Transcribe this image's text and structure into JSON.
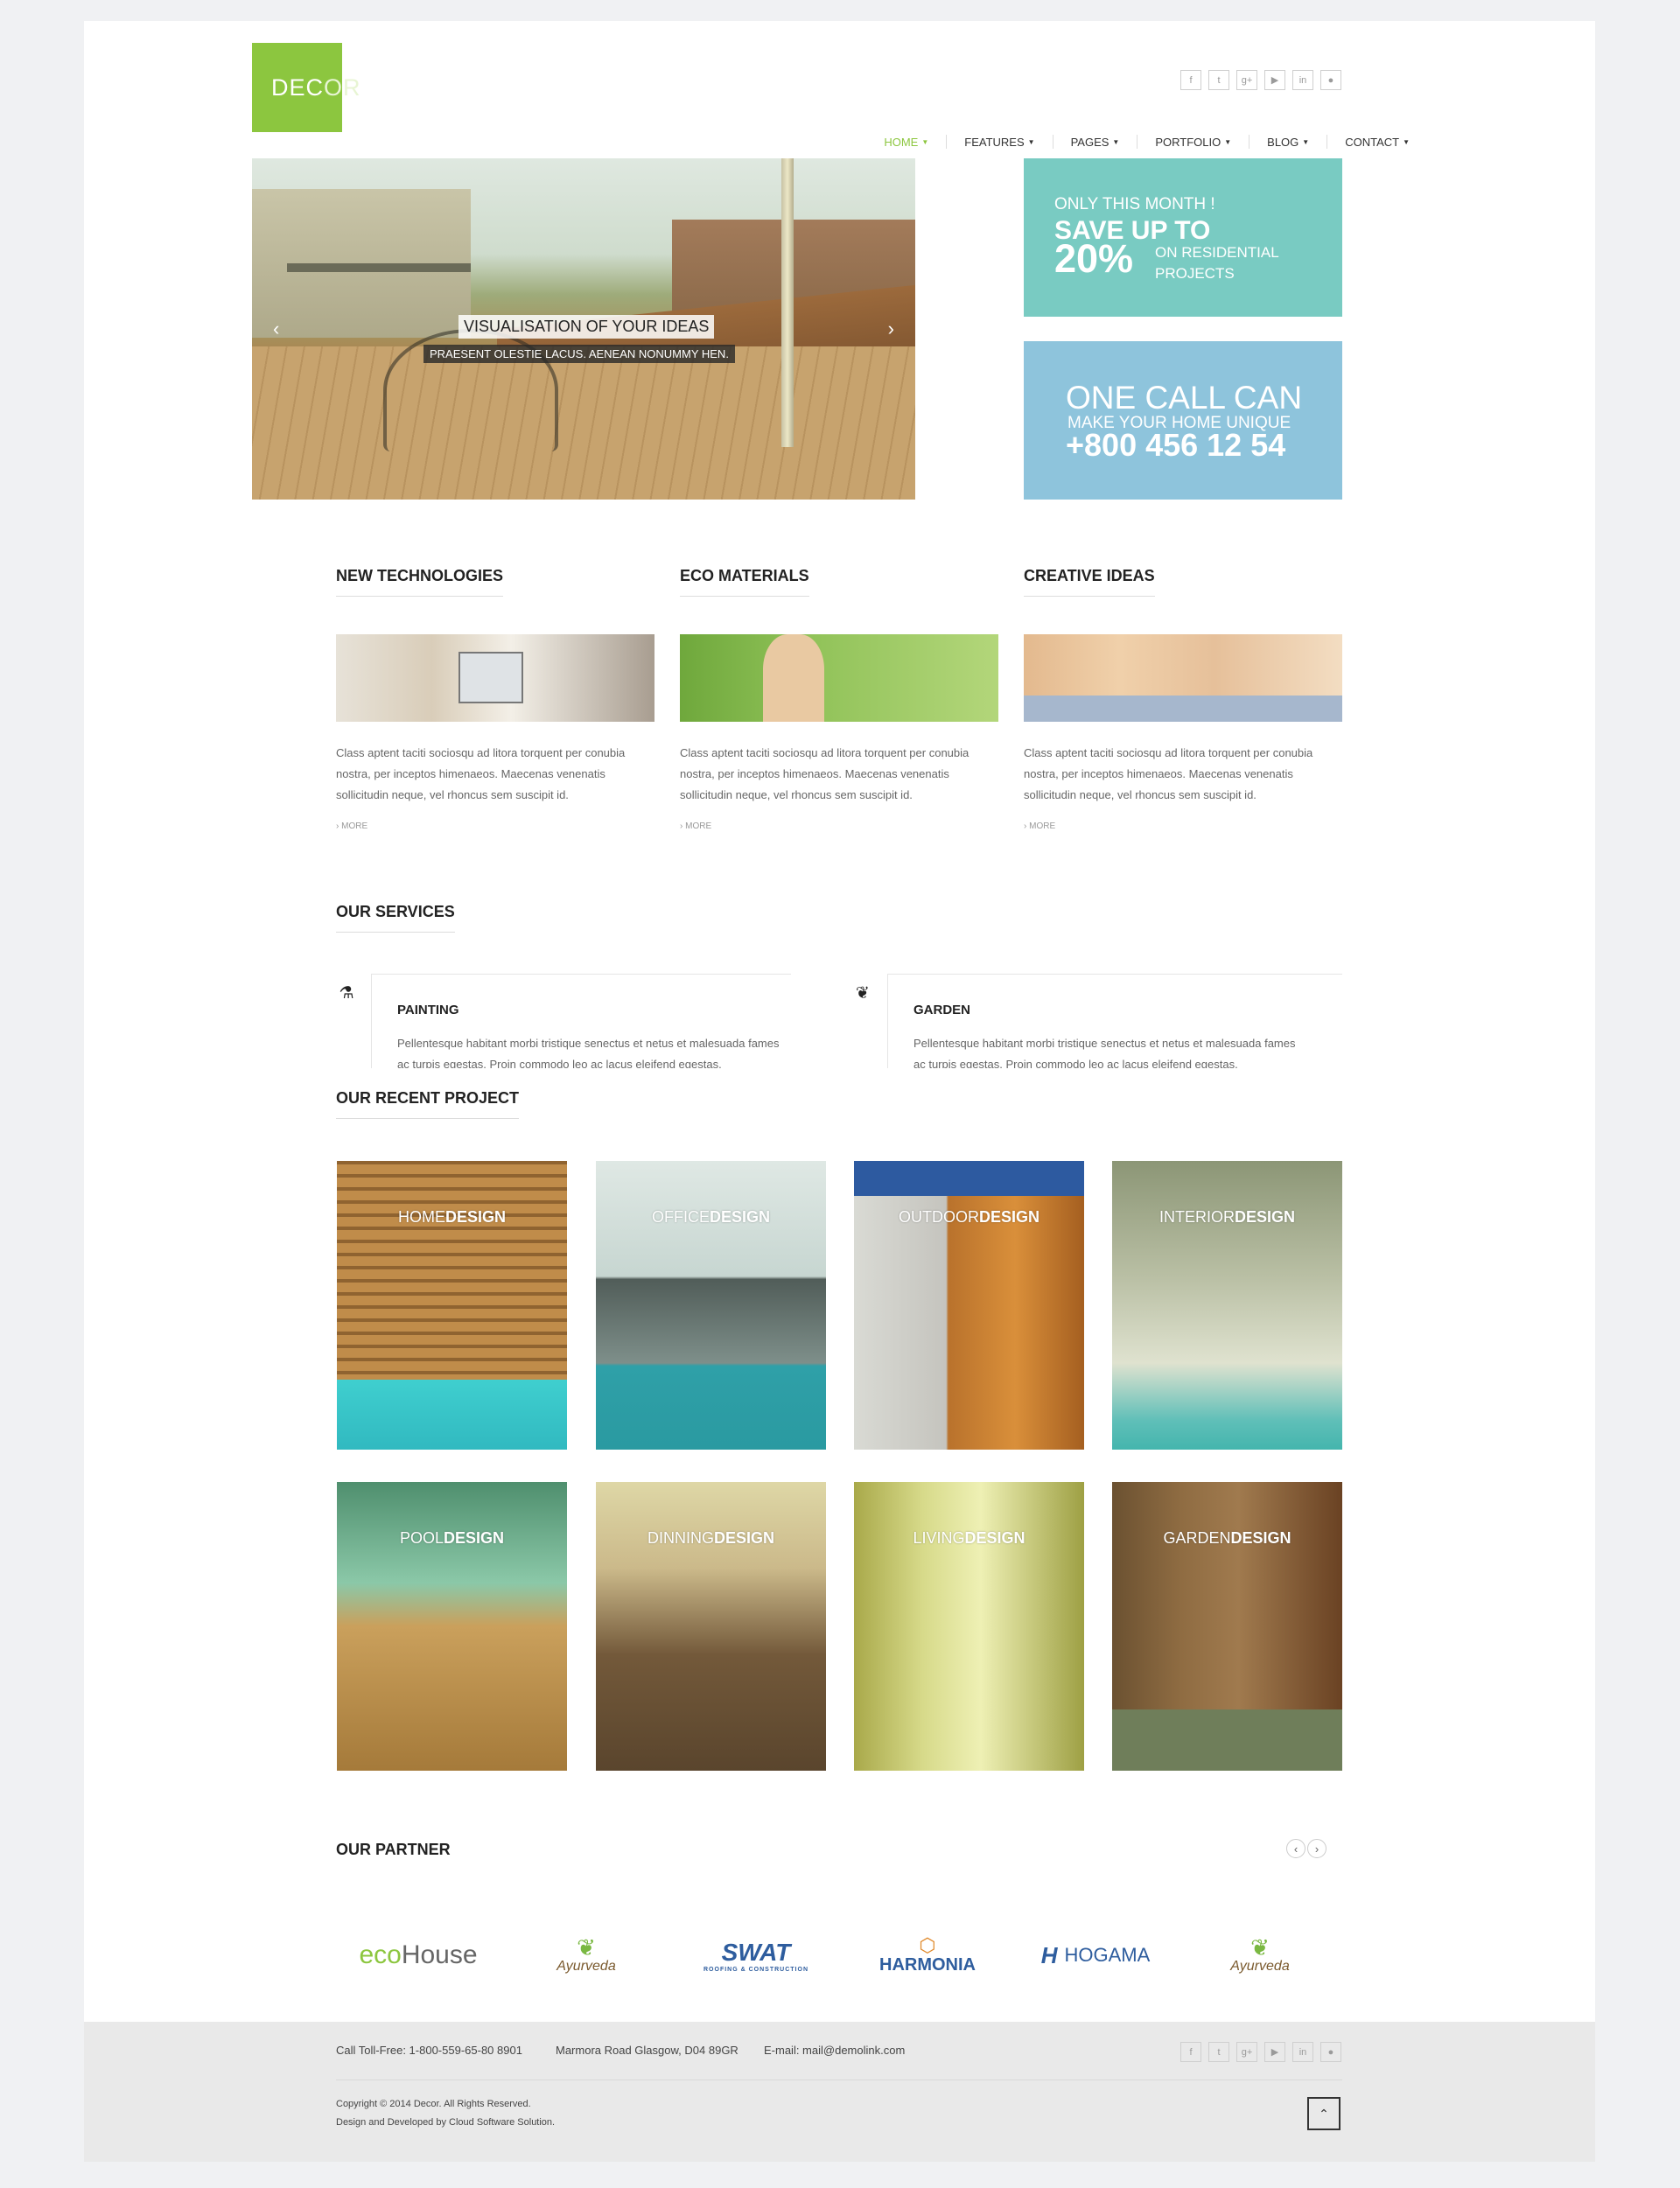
{
  "header": {
    "logo": {
      "prefix": "DEC",
      "suffix": "OR"
    },
    "social_icons": [
      "facebook-icon",
      "twitter-icon",
      "google-plus-icon",
      "youtube-icon",
      "linkedin-icon",
      "flickr-icon"
    ],
    "social_glyphs": [
      "f",
      "t",
      "g+",
      "▶",
      "in",
      "●"
    ],
    "nav": [
      {
        "label": "HOME",
        "active": true
      },
      {
        "label": "FEATURES",
        "active": false
      },
      {
        "label": "PAGES",
        "active": false
      },
      {
        "label": "PORTFOLIO",
        "active": false
      },
      {
        "label": "BLOG",
        "active": false
      },
      {
        "label": "CONTACT",
        "active": false
      }
    ]
  },
  "slider": {
    "caption_title": "VISUALISATION OF YOUR IDEAS",
    "caption_text": "PRAESENT OLESTIE LACUS. AENEAN NONUMMY HEN.",
    "prev": "‹",
    "next": "›"
  },
  "promo_offer": {
    "line1": "ONLY THIS MONTH !",
    "line2": "SAVE UP TO",
    "percent": "20%",
    "detail": "ON RESIDENTIAL PROJECTS"
  },
  "promo_call": {
    "line1": "ONE CALL CAN",
    "line2": "MAKE YOUR HOME UNIQUE",
    "phone": "+800 456 12 54"
  },
  "features": [
    {
      "title": "NEW TECHNOLOGIES",
      "text": "Class aptent taciti sociosqu ad litora torquent per conubia nostra, per inceptos himenaeos. Maecenas venenatis sollicitudin neque, vel rhoncus sem suscipit id.",
      "more": "› MORE"
    },
    {
      "title": "ECO MATERIALS",
      "text": "Class aptent taciti sociosqu ad litora torquent per conubia nostra, per inceptos himenaeos. Maecenas venenatis sollicitudin neque, vel rhoncus sem suscipit id.",
      "more": "› MORE"
    },
    {
      "title": "CREATIVE IDEAS",
      "text": "Class aptent taciti sociosqu ad litora torquent per conubia nostra, per inceptos himenaeos. Maecenas venenatis sollicitudin neque, vel rhoncus sem suscipit id.",
      "more": "› MORE"
    }
  ],
  "services": {
    "title": "OUR SERVICES",
    "items": [
      {
        "icon": "flask-icon",
        "glyph": "⚗",
        "title": "PAINTING",
        "text": "Pellentesque habitant morbi tristique senectus et netus et malesuada fames ac turpis egestas. Proin commodo leo ac lacus eleifend egestas."
      },
      {
        "icon": "leaf-icon",
        "glyph": "❦",
        "title": "GARDEN",
        "text": "Pellentesque habitant morbi tristique senectus et netus et malesuada fames ac turpis egestas. Proin commodo leo ac lacus eleifend egestas."
      }
    ]
  },
  "projects": {
    "title": "OUR RECENT PROJECT",
    "items": [
      {
        "light": "HOME",
        "bold": "DESIGN"
      },
      {
        "light": "OFFICE",
        "bold": "DESIGN"
      },
      {
        "light": "OUTDOOR",
        "bold": "DESIGN"
      },
      {
        "light": "INTERIOR",
        "bold": "DESIGN"
      },
      {
        "light": "POOL",
        "bold": "DESIGN"
      },
      {
        "light": "DINNING",
        "bold": "DESIGN"
      },
      {
        "light": "LIVING",
        "bold": "DESIGN"
      },
      {
        "light": "GARDEN",
        "bold": "DESIGN"
      }
    ]
  },
  "partners": {
    "title": "OUR PARTNER",
    "prev": "‹",
    "next": "›",
    "logos": {
      "ecohouse_a": "eco",
      "ecohouse_b": "House",
      "ayurveda": "Ayurveda",
      "swat": "SWAT",
      "swat_sub": "ROOFING & CONSTRUCTION",
      "harmonia": "HARMONIA",
      "hogama": "HOGAMA",
      "hogama_mark": "H"
    }
  },
  "footer": {
    "phone": "Call Toll-Free: 1-800-559-65-80 8901",
    "address": "Marmora Road Glasgow, D04 89GR",
    "email": "E-mail: mail@demolink.com",
    "copyright": "Copyright © 2014 Decor. All Rights Reserved.",
    "credits": "Design and Developed by Cloud Software Solution.",
    "to_top": "⌃"
  }
}
